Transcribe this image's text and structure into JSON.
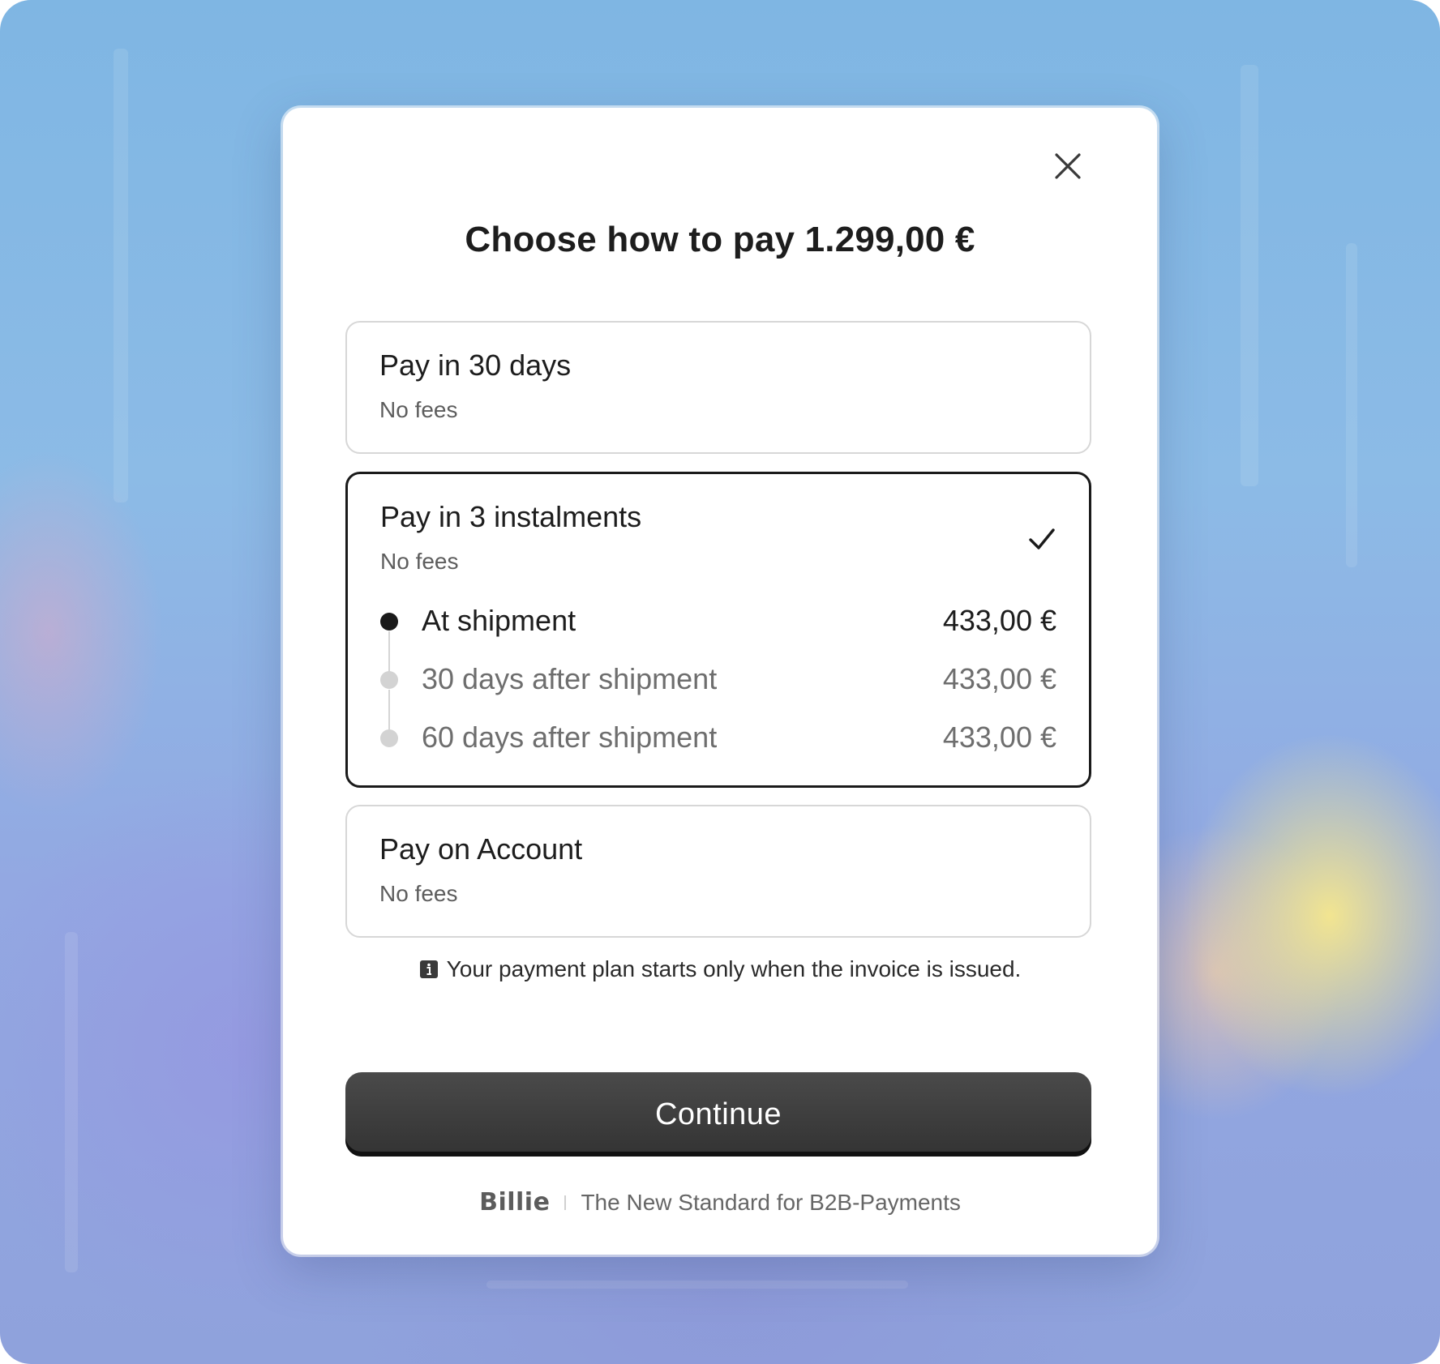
{
  "modal": {
    "close_icon": "close-icon",
    "title": "Choose how to pay 1.299,00 €",
    "options": [
      {
        "title": "Pay in 30 days",
        "subtitle": "No fees",
        "selected": false
      },
      {
        "title": "Pay in 3 instalments",
        "subtitle": "No fees",
        "selected": true,
        "check_icon": "checkmark-icon",
        "schedule": [
          {
            "label": "At shipment",
            "amount": "433,00 €",
            "active": true
          },
          {
            "label": "30 days after shipment",
            "amount": "433,00 €",
            "active": false
          },
          {
            "label": "60 days after shipment",
            "amount": "433,00 €",
            "active": false
          }
        ]
      },
      {
        "title": "Pay on Account",
        "subtitle": "No fees",
        "selected": false
      }
    ],
    "notice": {
      "icon": "info-icon",
      "text": "Your payment plan starts only when the invoice is issued."
    },
    "continue_label": "Continue",
    "footer": {
      "logo_text": "Billie",
      "tagline": "The New Standard for B2B-Payments"
    }
  },
  "colors": {
    "selected_border": "#1a1a1a",
    "default_border": "#d7d7d7",
    "button_bg": "#3a3a3a",
    "active_text": "#1d1d1d",
    "inactive_text": "#6e6e6e",
    "inactive_dot": "#d3d3d3"
  }
}
